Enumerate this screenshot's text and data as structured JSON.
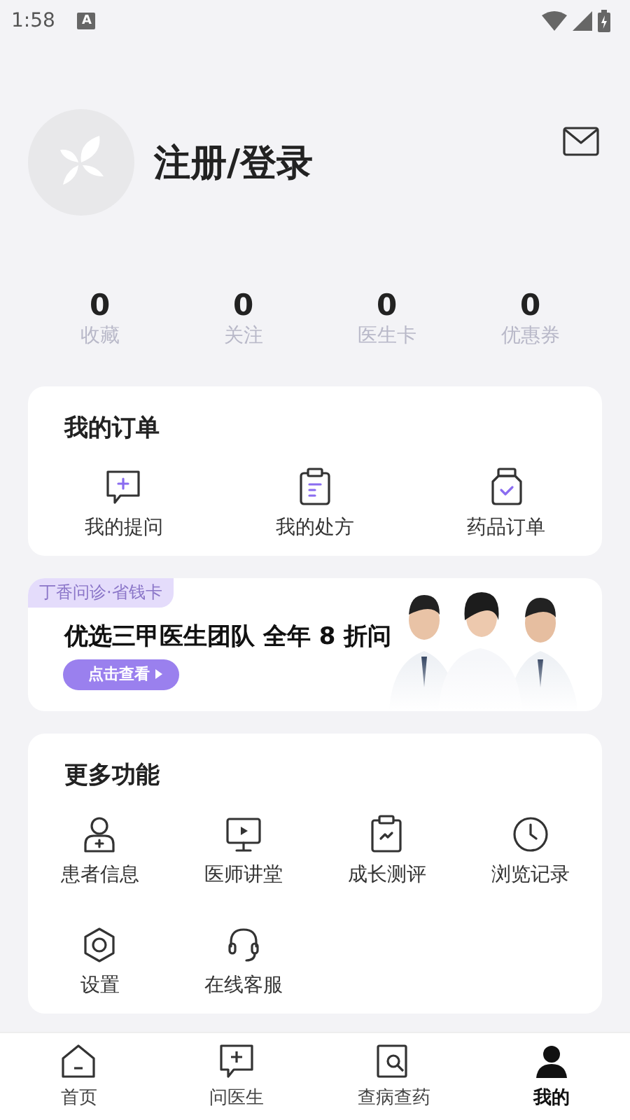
{
  "status_bar": {
    "time": "1:58",
    "badge": "A"
  },
  "profile": {
    "title": "注册/登录"
  },
  "stats": [
    {
      "value": "0",
      "label": "收藏"
    },
    {
      "value": "0",
      "label": "关注"
    },
    {
      "value": "0",
      "label": "医生卡"
    },
    {
      "value": "0",
      "label": "优惠券"
    }
  ],
  "orders": {
    "title": "我的订单",
    "items": [
      {
        "label": "我的提问"
      },
      {
        "label": "我的处方"
      },
      {
        "label": "药品订单"
      }
    ]
  },
  "banner": {
    "tag": "丁香问诊·省钱卡",
    "headline": "优选三甲医生团队 全年 8 折问",
    "button": "点击查看"
  },
  "features": {
    "title": "更多功能",
    "items": [
      {
        "label": "患者信息"
      },
      {
        "label": "医师讲堂"
      },
      {
        "label": "成长测评"
      },
      {
        "label": "浏览记录"
      },
      {
        "label": "设置"
      },
      {
        "label": "在线客服"
      }
    ]
  },
  "tabs": [
    {
      "label": "首页",
      "selected": false
    },
    {
      "label": "问医生",
      "selected": false
    },
    {
      "label": "查病查药",
      "selected": false
    },
    {
      "label": "我的",
      "selected": true
    }
  ]
}
